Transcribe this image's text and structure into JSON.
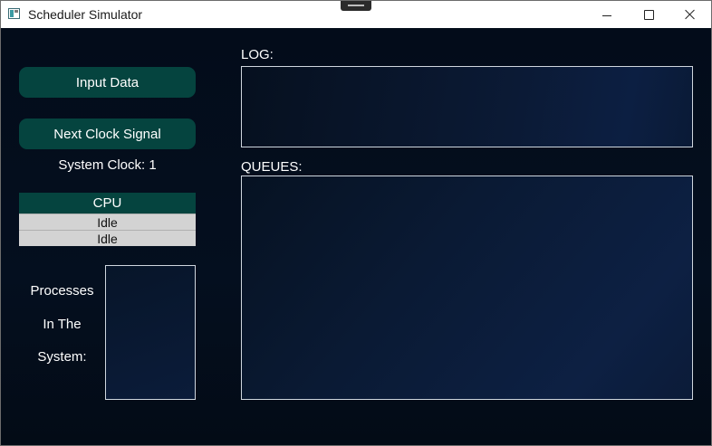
{
  "window": {
    "title": "Scheduler Simulator",
    "icons": {
      "app": "app-icon",
      "minimize": "minimize-icon",
      "maximize": "maximize-icon",
      "close": "close-icon"
    }
  },
  "controls": {
    "input_data_label": "Input Data",
    "next_clock_label": "Next Clock Signal"
  },
  "system_clock": {
    "text": "System Clock: 1"
  },
  "cpu": {
    "header": "CPU",
    "cores": [
      "Idle",
      "Idle"
    ]
  },
  "processes": {
    "label_lines": [
      "Processes",
      "In The",
      "System:"
    ]
  },
  "log": {
    "label": "LOG:"
  },
  "queues": {
    "label": "QUEUES:"
  },
  "colors": {
    "background": "#030b17",
    "button": "#05443f",
    "cpu_row": "#d3d3d3",
    "panel_border": "#cfd6de"
  }
}
